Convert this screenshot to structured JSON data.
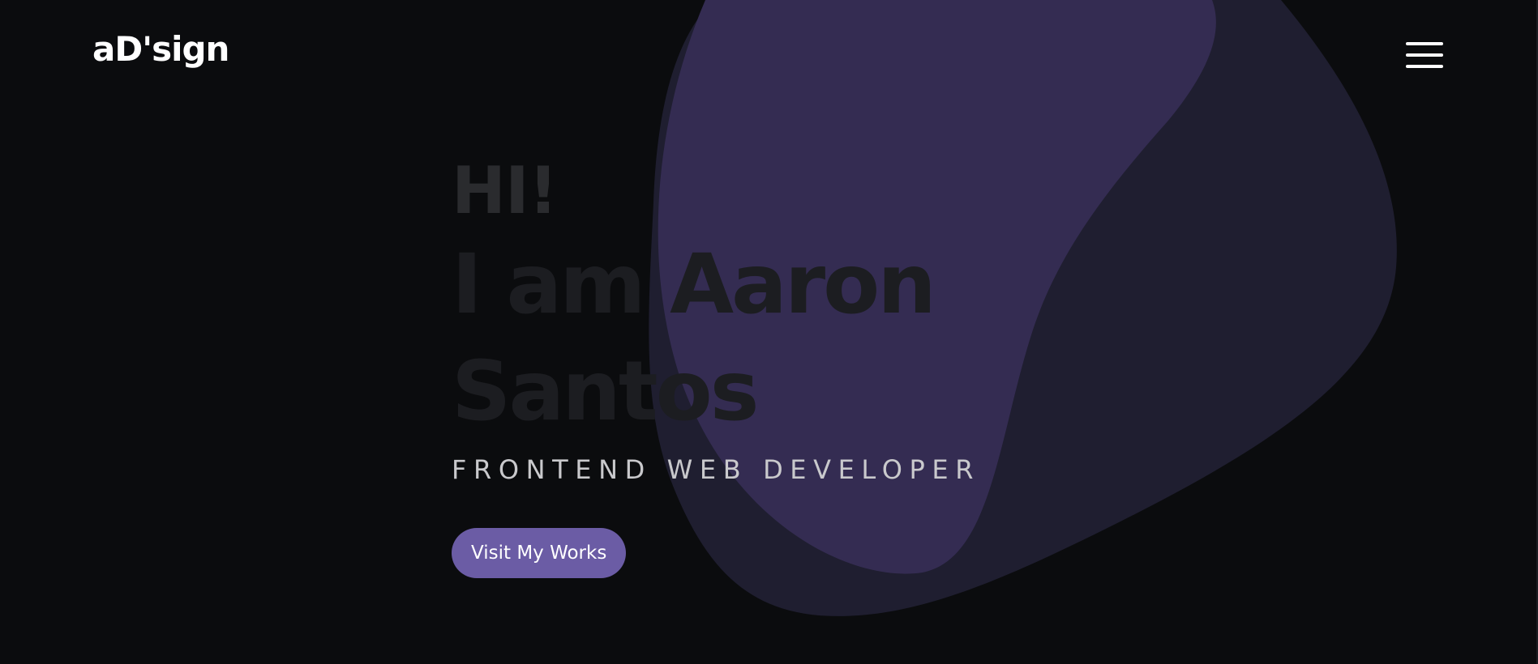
{
  "header": {
    "logo_text": "aD'sign",
    "menu_icon": "hamburger-menu-icon"
  },
  "hero": {
    "greeting": "HI!",
    "name": "I am Aaron Santos",
    "role": "FRONTEND WEB DEVELOPER",
    "cta_label": "Visit My Works"
  },
  "colors": {
    "background": "#0b0c0e",
    "blob_outer": "#1f1e30",
    "blob_inner": "#342c52",
    "accent": "#6b5ca5",
    "greeting": "#2a2b2e",
    "name": "#1c1d21",
    "role": "#c9c9cc"
  }
}
